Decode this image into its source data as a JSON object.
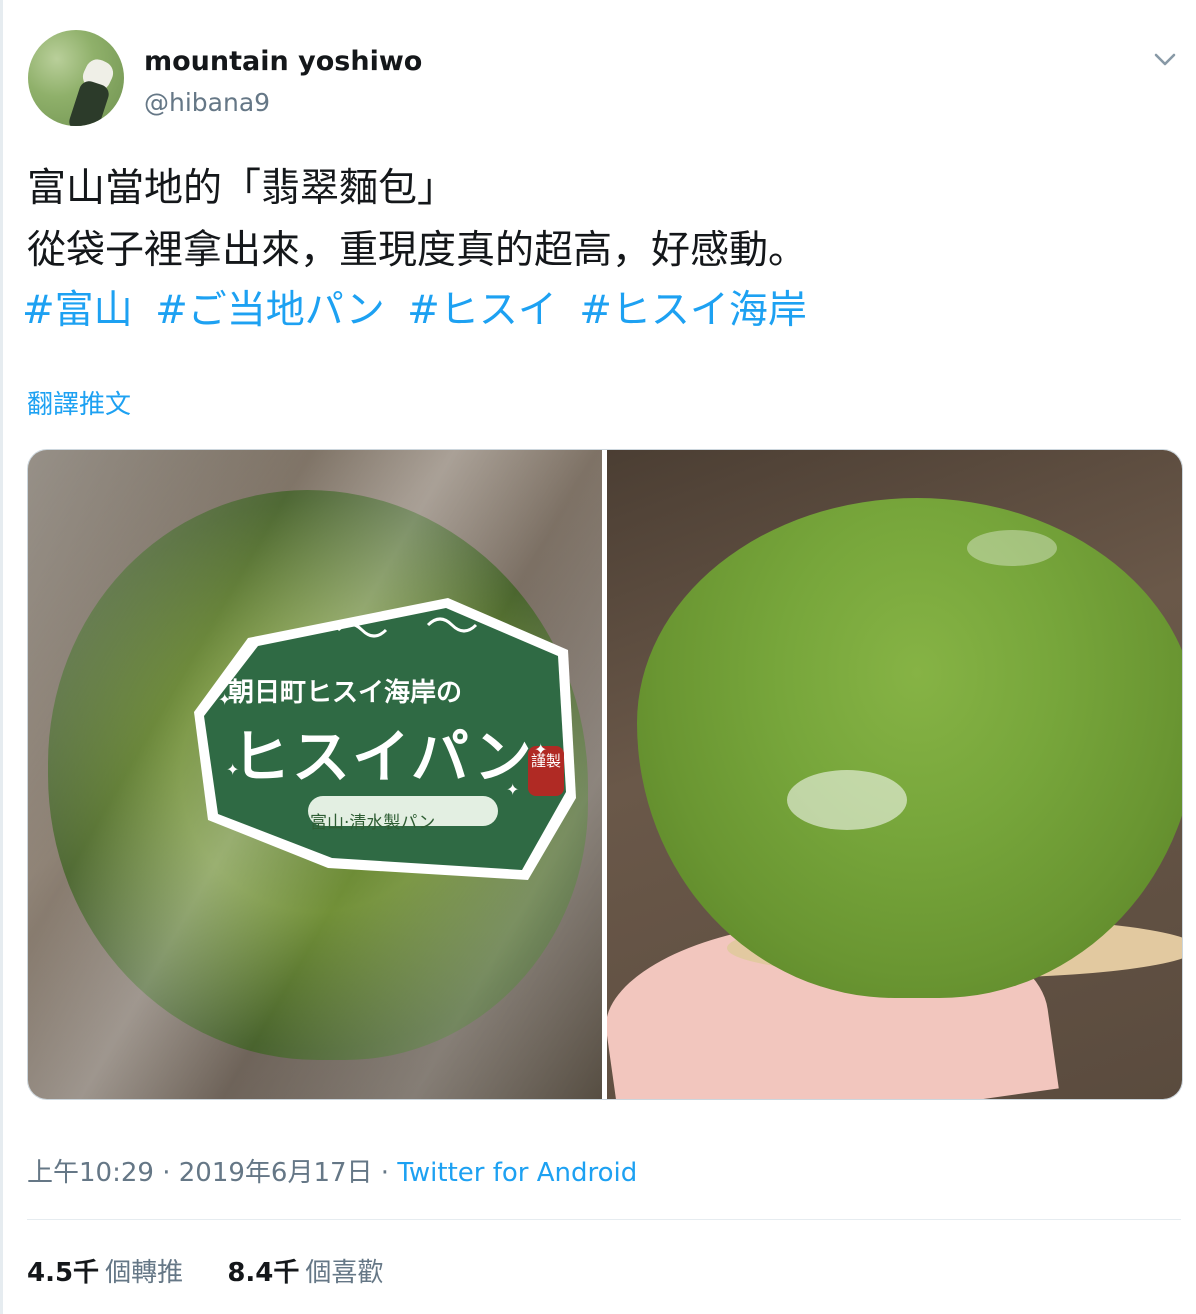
{
  "tweet": {
    "author": {
      "display_name": "mountain yoshiwo",
      "handle": "@hibana9"
    },
    "text_line1": "富山當地的「翡翠麵包」",
    "text_line2": "從袋子裡拿出來，重現度真的超高，好感動。",
    "hashtags": [
      "#富山",
      "#ご当地パン",
      "#ヒスイ",
      "#ヒスイ海岸"
    ],
    "translate_label": "翻譯推文",
    "media": {
      "photo_left": {
        "label_line1": "朝日町ヒスイ海岸の",
        "label_line2": "ヒスイパン",
        "label_line3": "富山·清水製パン",
        "seal_text": "謹製"
      }
    },
    "time": "上午10:29",
    "date": "2019年6月17日",
    "separator": "·",
    "source": "Twitter for Android",
    "stats": {
      "retweets_num": "4.5千",
      "retweets_label": "個轉推",
      "likes_num": "8.4千",
      "likes_label": "個喜歡"
    },
    "colors": {
      "link": "#1da1f2",
      "secondary": "#657786",
      "border": "#e6ecf0"
    }
  }
}
